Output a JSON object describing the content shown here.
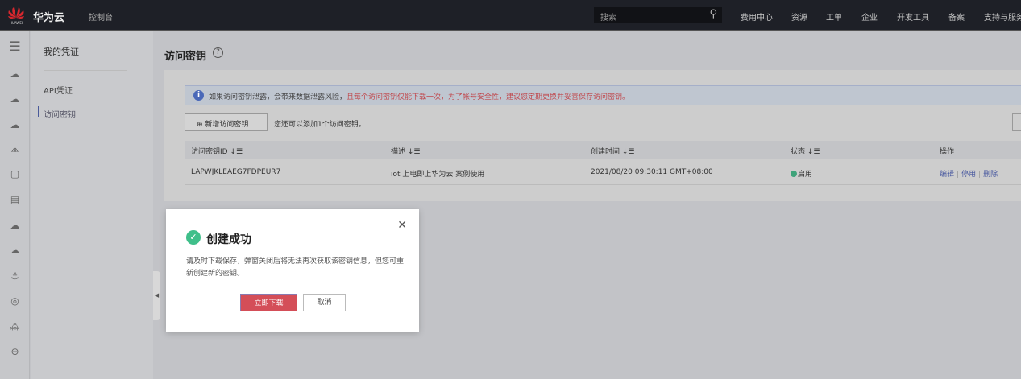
{
  "topbar": {
    "logo_text": "HUAWEI",
    "brand": "华为云",
    "console": "控制台",
    "search_placeholder": "搜索",
    "nav": [
      "费用中心",
      "资源",
      "工单",
      "企业",
      "开发工具",
      "备案",
      "支持与服务"
    ]
  },
  "sidebar": {
    "title": "我的凭证",
    "items": [
      {
        "label": "API凭证",
        "active": false
      },
      {
        "label": "访问密钥",
        "active": true
      }
    ]
  },
  "rail_icons": [
    "menu-icon",
    "cloud-icon",
    "cloud-more-icon",
    "cloud-list-icon",
    "monitor-icon",
    "device-icon",
    "document-icon",
    "cloud-storage-icon",
    "cloud-sync-icon",
    "anchor-icon",
    "ip-icon",
    "network-icon",
    "globe-icon"
  ],
  "page": {
    "title": "访问密钥",
    "info_normal": "如果访问密钥泄露，会带来数据泄露风险，",
    "info_red": "且每个访问密钥仅能下载一次，为了帐号安全性，建议您定期更换并妥善保存访问密钥。",
    "add_button": "新增访问密钥",
    "add_tip": "您还可以添加1个访问密钥。",
    "table": {
      "columns": [
        "访问密钥ID",
        "描述",
        "创建时间",
        "状态",
        "操作"
      ],
      "rows": [
        {
          "id": "LAPWJKLEAEG7FDPEUR7",
          "desc": "iot 上电即上华为云 案例使用",
          "created": "2021/08/20 09:30:11 GMT+08:00",
          "status": "启用",
          "actions": [
            "编辑",
            "停用",
            "删除"
          ]
        }
      ]
    }
  },
  "dialog": {
    "title": "创建成功",
    "message": "请及时下载保存，弹窗关闭后将无法再次获取该密钥信息，但您可重新创建新的密钥。",
    "download": "立即下载",
    "cancel": "取消"
  },
  "colors": {
    "accent_red": "#d44e58",
    "success": "#3fbf8a",
    "info": "#4a68b8"
  }
}
